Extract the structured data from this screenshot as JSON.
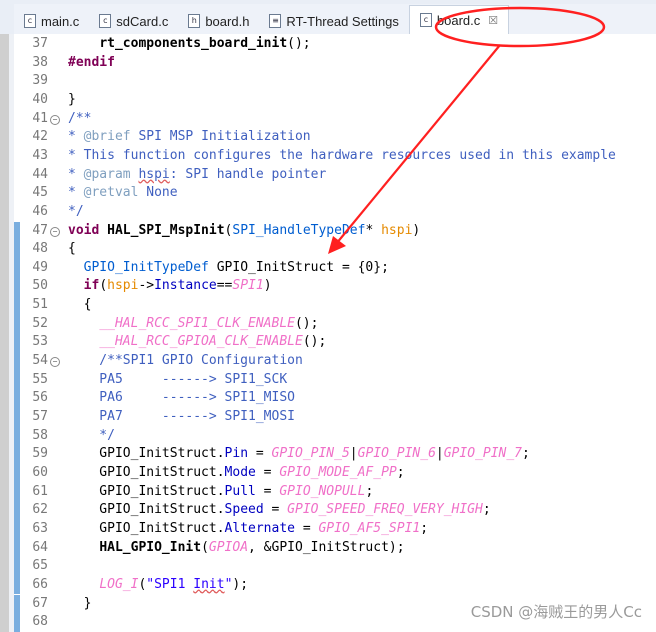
{
  "tabs": [
    {
      "label": "main.c",
      "icon": "c-file-icon",
      "glyph": "c",
      "active": false
    },
    {
      "label": "sdCard.c",
      "icon": "c-file-icon",
      "glyph": "c",
      "active": false
    },
    {
      "label": "board.h",
      "icon": "h-file-icon",
      "glyph": "h",
      "active": false
    },
    {
      "label": "RT-Thread Settings",
      "icon": "settings-file-icon",
      "glyph": "≡",
      "active": false
    },
    {
      "label": "board.c",
      "icon": "c-file-icon",
      "glyph": "c",
      "active": true,
      "close": "☒"
    }
  ],
  "colors": {
    "annotation": "#ff2020",
    "changed_rule": "#7aaedf",
    "keyword": "#7f0055",
    "macro": "#f070c8",
    "comment": "#3f5fbf"
  },
  "lines": [
    {
      "n": "37",
      "changed": false,
      "t": [
        [
          "    ",
          "o"
        ],
        [
          "rt_components_board_init",
          "f"
        ],
        [
          "();",
          "o"
        ]
      ]
    },
    {
      "n": "38",
      "changed": false,
      "t": [
        [
          "#endif",
          "k"
        ]
      ]
    },
    {
      "n": "39",
      "changed": false,
      "t": []
    },
    {
      "n": "40",
      "changed": false,
      "t": [
        [
          "}",
          "o"
        ]
      ]
    },
    {
      "n": "41",
      "changed": false,
      "fold": true,
      "t": [
        [
          "/**",
          "c"
        ]
      ]
    },
    {
      "n": "42",
      "changed": false,
      "t": [
        [
          "* ",
          "c"
        ],
        [
          "@brief",
          "ct"
        ],
        [
          " SPI MSP Initialization",
          "c"
        ]
      ]
    },
    {
      "n": "43",
      "changed": false,
      "t": [
        [
          "* This function configures the hardware resources used in this example",
          "c"
        ]
      ]
    },
    {
      "n": "44",
      "changed": false,
      "t": [
        [
          "* ",
          "c"
        ],
        [
          "@param",
          "ct"
        ],
        [
          " ",
          "c"
        ],
        [
          "hspi",
          "c sq"
        ],
        [
          ": SPI handle pointer",
          "c"
        ]
      ]
    },
    {
      "n": "45",
      "changed": false,
      "t": [
        [
          "* ",
          "c"
        ],
        [
          "@retval",
          "ct"
        ],
        [
          " None",
          "c"
        ]
      ]
    },
    {
      "n": "46",
      "changed": false,
      "t": [
        [
          "*/",
          "c"
        ]
      ]
    },
    {
      "n": "47",
      "changed": true,
      "fold": true,
      "t": [
        [
          "void",
          "k"
        ],
        [
          " ",
          "o"
        ],
        [
          "HAL_SPI_MspInit",
          "f"
        ],
        [
          "(",
          "o"
        ],
        [
          "SPI_HandleTypeDef",
          "t"
        ],
        [
          "* ",
          "o"
        ],
        [
          "hspi",
          "p"
        ],
        [
          ")",
          "o"
        ]
      ]
    },
    {
      "n": "48",
      "changed": true,
      "t": [
        [
          "{",
          "o"
        ]
      ]
    },
    {
      "n": "49",
      "changed": true,
      "t": [
        [
          "  ",
          "o"
        ],
        [
          "GPIO_InitTypeDef",
          "t"
        ],
        [
          " GPIO_InitStruct = {0};",
          "o"
        ]
      ]
    },
    {
      "n": "50",
      "changed": true,
      "t": [
        [
          "  ",
          "o"
        ],
        [
          "if",
          "k"
        ],
        [
          "(",
          "o"
        ],
        [
          "hspi",
          "p"
        ],
        [
          "->",
          "o"
        ],
        [
          "Instance",
          "d"
        ],
        [
          "==",
          "o"
        ],
        [
          "SPI1",
          "m"
        ],
        [
          ")",
          "o"
        ]
      ]
    },
    {
      "n": "51",
      "changed": true,
      "t": [
        [
          "  {",
          "o"
        ]
      ]
    },
    {
      "n": "52",
      "changed": true,
      "t": [
        [
          "    ",
          "o"
        ],
        [
          "__HAL_RCC_SPI1_CLK_ENABLE",
          "m"
        ],
        [
          "();",
          "o"
        ]
      ]
    },
    {
      "n": "53",
      "changed": true,
      "t": [
        [
          "    ",
          "o"
        ],
        [
          "__HAL_RCC_GPIOA_CLK_ENABLE",
          "m"
        ],
        [
          "();",
          "o"
        ]
      ]
    },
    {
      "n": "54",
      "changed": true,
      "fold": true,
      "t": [
        [
          "    /**SPI1 GPIO Configuration",
          "c"
        ]
      ]
    },
    {
      "n": "55",
      "changed": true,
      "t": [
        [
          "    PA5     ------> SPI1_SCK",
          "c"
        ]
      ]
    },
    {
      "n": "56",
      "changed": true,
      "t": [
        [
          "    PA6     ------> SPI1_MISO",
          "c"
        ]
      ]
    },
    {
      "n": "57",
      "changed": true,
      "t": [
        [
          "    PA7     ------> SPI1_MOSI",
          "c"
        ]
      ]
    },
    {
      "n": "58",
      "changed": true,
      "t": [
        [
          "    */",
          "c"
        ]
      ]
    },
    {
      "n": "59",
      "changed": true,
      "t": [
        [
          "    GPIO_InitStruct.",
          "o"
        ],
        [
          "Pin",
          "d"
        ],
        [
          " = ",
          "o"
        ],
        [
          "GPIO_PIN_5",
          "m"
        ],
        [
          "|",
          "o"
        ],
        [
          "GPIO_PIN_6",
          "m"
        ],
        [
          "|",
          "o"
        ],
        [
          "GPIO_PIN_7",
          "m"
        ],
        [
          ";",
          "o"
        ]
      ]
    },
    {
      "n": "60",
      "changed": true,
      "t": [
        [
          "    GPIO_InitStruct.",
          "o"
        ],
        [
          "Mode",
          "d"
        ],
        [
          " = ",
          "o"
        ],
        [
          "GPIO_MODE_AF_PP",
          "m"
        ],
        [
          ";",
          "o"
        ]
      ]
    },
    {
      "n": "61",
      "changed": true,
      "t": [
        [
          "    GPIO_InitStruct.",
          "o"
        ],
        [
          "Pull",
          "d"
        ],
        [
          " = ",
          "o"
        ],
        [
          "GPIO_NOPULL",
          "m"
        ],
        [
          ";",
          "o"
        ]
      ]
    },
    {
      "n": "62",
      "changed": true,
      "t": [
        [
          "    GPIO_InitStruct.",
          "o"
        ],
        [
          "Speed",
          "d"
        ],
        [
          " = ",
          "o"
        ],
        [
          "GPIO_SPEED_FREQ_VERY_HIGH",
          "m"
        ],
        [
          ";",
          "o"
        ]
      ]
    },
    {
      "n": "63",
      "changed": true,
      "t": [
        [
          "    GPIO_InitStruct.",
          "o"
        ],
        [
          "Alternate",
          "d"
        ],
        [
          " = ",
          "o"
        ],
        [
          "GPIO_AF5_SPI1",
          "m"
        ],
        [
          ";",
          "o"
        ]
      ]
    },
    {
      "n": "64",
      "changed": true,
      "t": [
        [
          "    ",
          "o"
        ],
        [
          "HAL_GPIO_Init",
          "f"
        ],
        [
          "(",
          "o"
        ],
        [
          "GPIOA",
          "m"
        ],
        [
          ", &GPIO_InitStruct);",
          "o"
        ]
      ]
    },
    {
      "n": "65",
      "changed": true,
      "t": []
    },
    {
      "n": "66",
      "changed": true,
      "t": [
        [
          "    ",
          "o"
        ],
        [
          "LOG_I",
          "m"
        ],
        [
          "(",
          "o"
        ],
        [
          "\"SPI1 ",
          "s"
        ],
        [
          "Init",
          "s sq"
        ],
        [
          "\"",
          "s"
        ],
        [
          ");",
          "o"
        ]
      ]
    },
    {
      "n": "67",
      "changed": true,
      "t": [
        [
          "  }",
          "o"
        ]
      ]
    },
    {
      "n": "68",
      "changed": true,
      "t": []
    }
  ],
  "watermark": "CSDN @海贼王的男人Cc"
}
